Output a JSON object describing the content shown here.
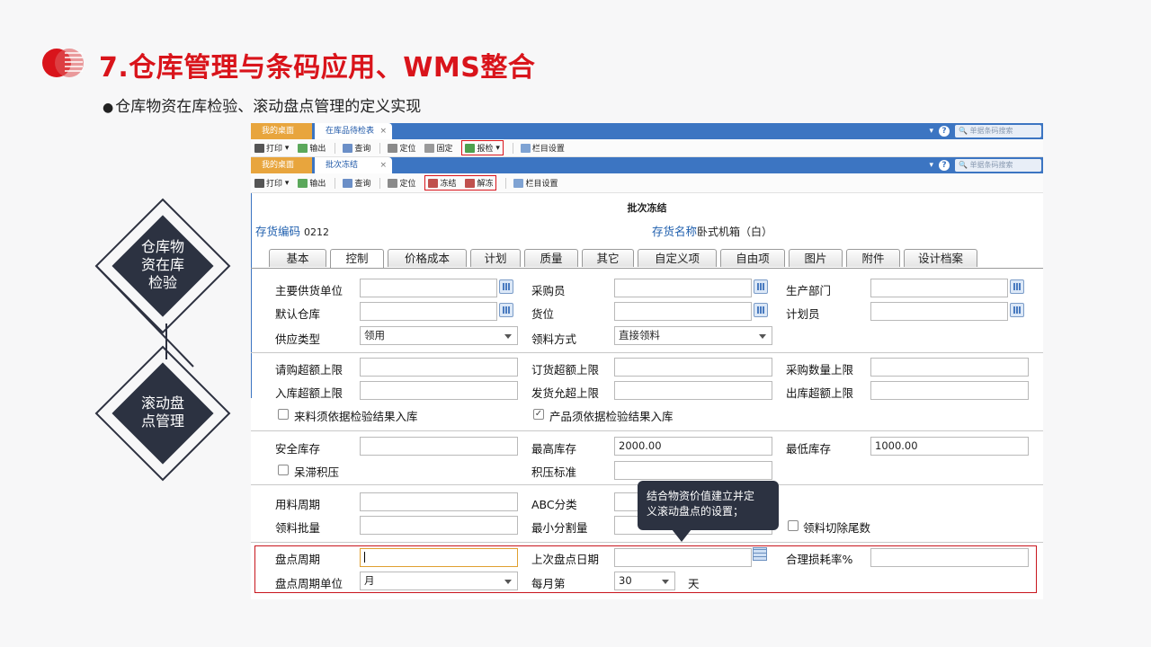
{
  "slide": {
    "title": "7.仓库管理与条码应用、WMS整合",
    "bullet": "仓库物资在库检验、滚动盘点管理的定义实现",
    "diamond1": [
      "仓库物",
      "资在库",
      "检验"
    ],
    "diamond2": [
      "滚动盘",
      "点管理"
    ],
    "colors": {
      "accent": "#d9141b",
      "dark": "#2c3241",
      "tab_blue": "#3c75c2",
      "tab_orange": "#e8a53d"
    }
  },
  "window1": {
    "tab_home": "我的桌面",
    "tab_active": "在库品待检表",
    "close": "×",
    "help": "?",
    "search_placeholder": "单据条码搜索",
    "toolbar": [
      "打印",
      "输出",
      "查询",
      "定位",
      "固定",
      "报检",
      "栏目设置"
    ]
  },
  "window2": {
    "tab_home": "我的桌面",
    "tab_active": "批次冻结",
    "close": "×",
    "help": "?",
    "search_placeholder": "单据条码搜索",
    "toolbar": [
      "打印",
      "输出",
      "查询",
      "定位",
      "冻结",
      "解冻",
      "栏目设置"
    ]
  },
  "form": {
    "title": "批次冻结",
    "code_label": "存货编码",
    "code_value": "0212",
    "name_label": "存货名称",
    "name_value": "卧式机箱（白）",
    "tabs": [
      "基本",
      "控制",
      "价格成本",
      "计划",
      "质量",
      "其它",
      "自定义项",
      "自由项",
      "图片",
      "附件",
      "设计档案"
    ],
    "labels": {
      "main_supplier": "主要供货单位",
      "buyer": "采购员",
      "prod_dept": "生产部门",
      "default_wh": "默认仓库",
      "location": "货位",
      "planner": "计划员",
      "supply_type": "供应类型",
      "issue_method": "领料方式",
      "req_over": "请购超额上限",
      "order_over": "订货超额上限",
      "purchase_qty_max": "采购数量上限",
      "in_over": "入库超额上限",
      "ship_over": "发货允超上限",
      "out_over": "出库超额上限",
      "check_in_inspect": "来料须依据检验结果入库",
      "check_prod_inspect": "产品须依据检验结果入库",
      "safety_stock": "安全库存",
      "max_stock": "最高库存",
      "min_stock": "最低库存",
      "stagnant": "呆滞积压",
      "press_std": "积压标准",
      "usage_period": "用料周期",
      "abc": "ABC分类",
      "issue_batch": "领料批量",
      "min_split": "最小分割量",
      "issue_cut_tail": "领料切除尾数",
      "count_period": "盘点周期",
      "last_count_date": "上次盘点日期",
      "loss_rate": "合理损耗率%",
      "count_period_unit": "盘点周期单位",
      "per_month": "每月第",
      "day": "天"
    },
    "values": {
      "supply_type": "领用",
      "issue_method": "直接领料",
      "max_stock": "2000.00",
      "min_stock": "1000.00",
      "count_period_unit": "月",
      "per_month": "30"
    },
    "tooltip": [
      "结合物资价值建立并定",
      "义滚动盘点的设置；"
    ]
  }
}
